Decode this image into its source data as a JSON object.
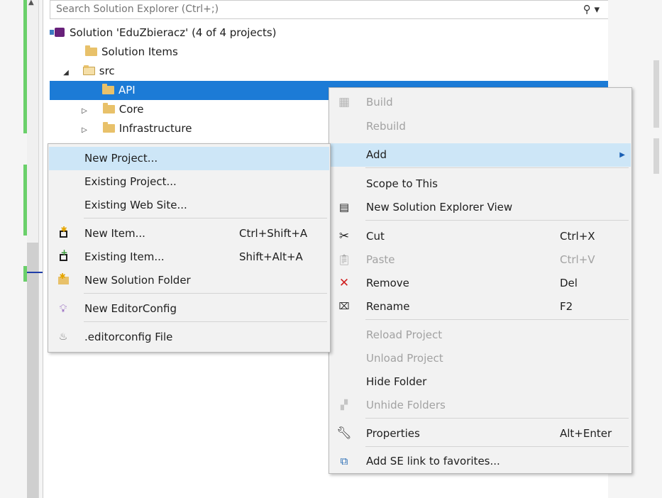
{
  "search": {
    "placeholder": "Search Solution Explorer (Ctrl+;)"
  },
  "tree": {
    "solution": "Solution 'EduZbieracz' (4 of 4 projects)",
    "solution_items": "Solution Items",
    "src": "src",
    "api": "API",
    "core": "Core",
    "infrastructure": "Infrastructure"
  },
  "context_menu": {
    "build": "Build",
    "rebuild": "Rebuild",
    "add": "Add",
    "scope_to_this": "Scope to This",
    "new_view": "New Solution Explorer View",
    "cut": "Cut",
    "cut_shortcut": "Ctrl+X",
    "paste": "Paste",
    "paste_shortcut": "Ctrl+V",
    "remove": "Remove",
    "remove_shortcut": "Del",
    "rename": "Rename",
    "rename_shortcut": "F2",
    "reload_project": "Reload Project",
    "unload_project": "Unload Project",
    "hide_folder": "Hide Folder",
    "unhide_folders": "Unhide Folders",
    "properties": "Properties",
    "properties_shortcut": "Alt+Enter",
    "add_se_link": "Add SE link to favorites..."
  },
  "add_submenu": {
    "new_project": "New Project...",
    "existing_project": "Existing Project...",
    "existing_web_site": "Existing Web Site...",
    "new_item": "New Item...",
    "new_item_shortcut": "Ctrl+Shift+A",
    "existing_item": "Existing Item...",
    "existing_item_shortcut": "Shift+Alt+A",
    "new_solution_folder": "New Solution Folder",
    "new_editorconfig": "New EditorConfig",
    "editorconfig_file": ".editorconfig File"
  },
  "colors": {
    "selection": "#1c7bd6",
    "menu_highlight": "#cde6f7",
    "menu_background": "#f2f2f2",
    "disabled_text": "#a2a2a2",
    "git_added": "#6ad06a"
  },
  "icons": {
    "search": "search-icon",
    "solution": "solution-icon",
    "folder": "folder-icon",
    "build": "build-icon",
    "cut": "scissors-icon",
    "remove": "red-x-icon",
    "properties": "wrench-icon"
  }
}
